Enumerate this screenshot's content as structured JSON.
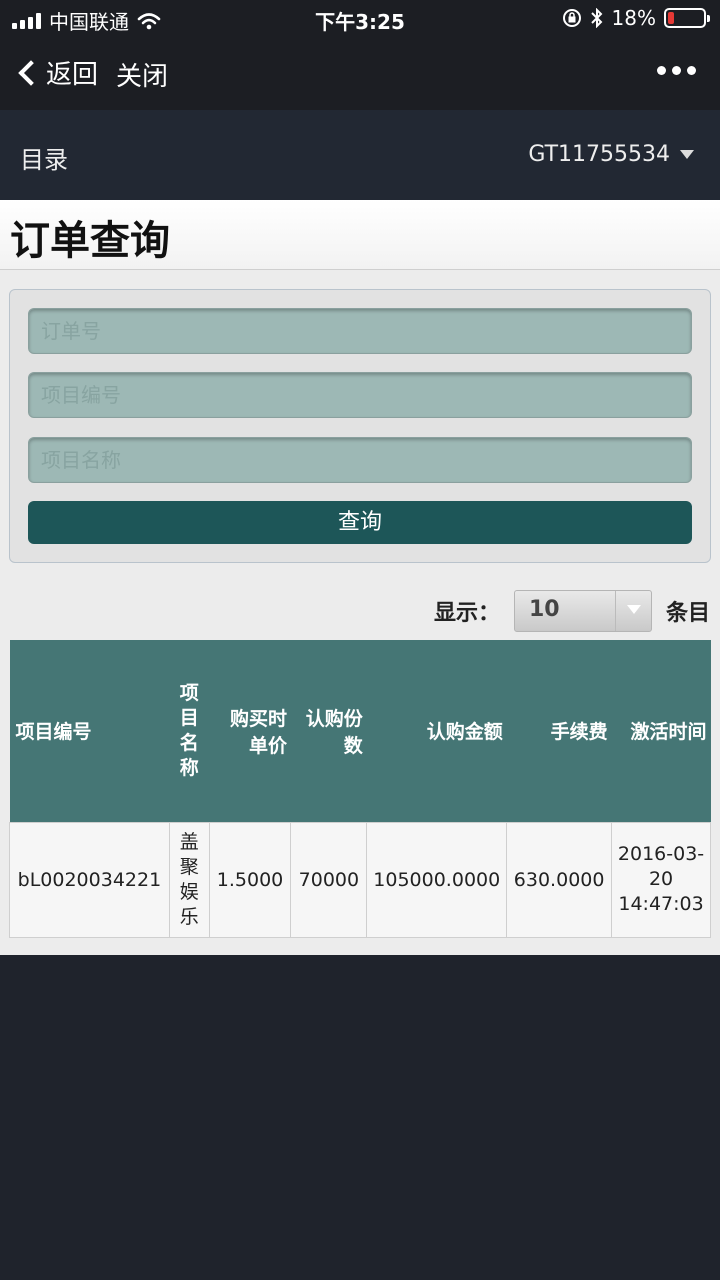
{
  "status_bar": {
    "carrier": "中国联通",
    "time": "下午3:25",
    "battery_percent": "18%",
    "battery_level": 0.18,
    "icons": [
      "signal-icon",
      "wifi-icon",
      "rotation-lock-icon",
      "bluetooth-icon",
      "battery-icon"
    ]
  },
  "nav": {
    "back_label": "返回",
    "close_label": "关闭"
  },
  "header": {
    "menu_label": "目录",
    "account_id": "GT11755534"
  },
  "page": {
    "title": "订单查询"
  },
  "search": {
    "order_placeholder": "订单号",
    "project_code_placeholder": "项目编号",
    "project_name_placeholder": "项目名称",
    "query_label": "查询"
  },
  "pager": {
    "show_label": "显示：",
    "page_size": "10",
    "unit_label": "条目"
  },
  "table": {
    "headers": [
      "项目编号",
      "项目名称",
      "购买时单价",
      "认购份数",
      "认购金额",
      "手续费",
      "激活时间"
    ],
    "rows": [
      [
        "bL0020034221",
        "盖聚娱乐",
        "1.5000",
        "70000",
        "105000.0000",
        "630.0000",
        "2016-03-20 14:47:03"
      ]
    ]
  },
  "colors": {
    "nav_bg": "#1c1e23",
    "header_bg": "#222833",
    "table_header_bg": "#457675",
    "button_bg": "#1d5658",
    "field_bg": "#9db8b5",
    "battery_low": "#e53935"
  }
}
